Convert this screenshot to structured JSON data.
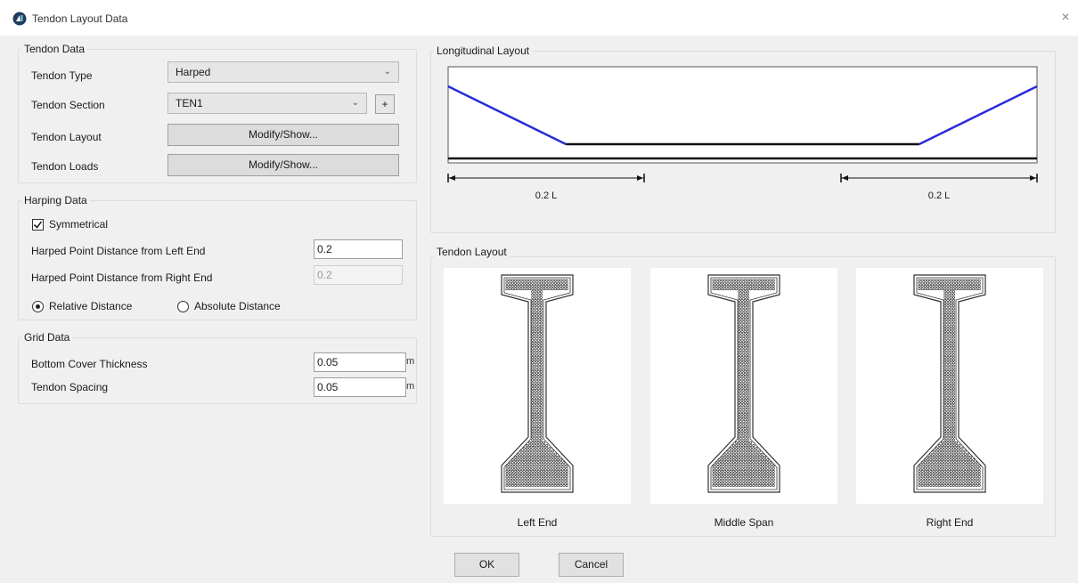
{
  "window": {
    "title": "Tendon Layout Data",
    "close_glyph": "×"
  },
  "tendon_data": {
    "title": "Tendon Data",
    "type_label": "Tendon Type",
    "type_value": "Harped",
    "section_label": "Tendon Section",
    "section_value": "TEN1",
    "add_label": "+",
    "layout_label": "Tendon Layout",
    "layout_button": "Modify/Show...",
    "loads_label": "Tendon Loads",
    "loads_button": "Modify/Show..."
  },
  "harping_data": {
    "title": "Harping Data",
    "symmetrical_label": "Symmetrical",
    "symmetrical_checked": true,
    "left_label": "Harped Point Distance from Left End",
    "left_value": "0.2",
    "right_label": "Harped Point Distance from Right End",
    "right_value": "0.2",
    "relative_label": "Relative Distance",
    "absolute_label": "Absolute Distance",
    "selected_mode": "relative"
  },
  "grid_data": {
    "title": "Grid Data",
    "bottom_cover_label": "Bottom Cover Thickness",
    "bottom_cover_value": "0.05",
    "bottom_cover_unit": "m",
    "spacing_label": "Tendon Spacing",
    "spacing_value": "0.05",
    "spacing_unit": "m"
  },
  "longitudinal_layout": {
    "title": "Longitudinal Layout",
    "left_dim_label": "0.2 L",
    "right_dim_label": "0.2 L",
    "tendon_color": "#2b2bd6",
    "harp_left_fraction": 0.2,
    "harp_right_fraction": 0.2
  },
  "tendon_layout": {
    "title": "Tendon Layout",
    "sections": [
      {
        "caption": "Left End"
      },
      {
        "caption": "Middle Span"
      },
      {
        "caption": "Right End"
      }
    ]
  },
  "buttons": {
    "ok": "OK",
    "cancel": "Cancel"
  }
}
